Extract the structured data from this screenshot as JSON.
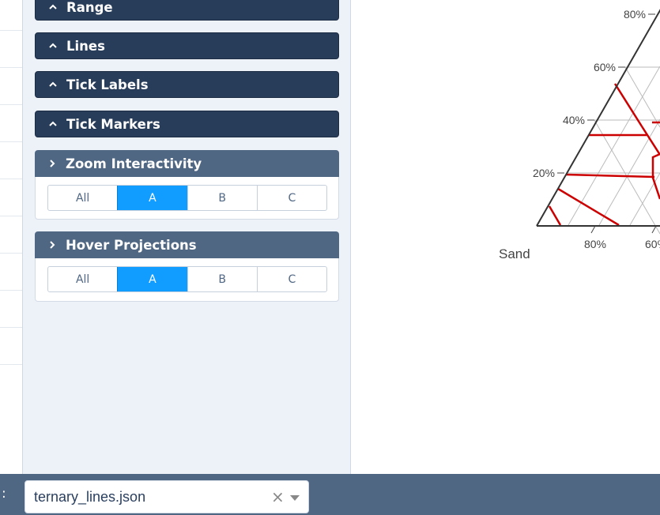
{
  "sections": [
    {
      "title": "Range",
      "state": "collapsed"
    },
    {
      "title": "Lines",
      "state": "collapsed"
    },
    {
      "title": "Tick Labels",
      "state": "collapsed"
    },
    {
      "title": "Tick Markers",
      "state": "collapsed"
    },
    {
      "title": "Zoom Interactivity",
      "state": "expanded",
      "options": [
        "All",
        "A",
        "B",
        "C"
      ],
      "selected": "A"
    },
    {
      "title": "Hover Projections",
      "state": "expanded",
      "options": [
        "All",
        "A",
        "B",
        "C"
      ],
      "selected": "A"
    }
  ],
  "plot": {
    "left_axis_ticks": [
      "80%",
      "60%",
      "40%",
      "20%"
    ],
    "bottom_axis_ticks": [
      "80%",
      "60%"
    ],
    "corner_label": "Sand",
    "line_color": "#cc0000",
    "grid_color": "#bbbbbb",
    "axis_color": "#333333"
  },
  "file_selector": {
    "label": ":",
    "value": "ternary_lines.json"
  },
  "colors": {
    "panel_bg": "#edf1f8",
    "header_dark": "#283d5a",
    "header_expanded": "#506783",
    "selected_option": "#119dff",
    "bottom_bar": "#506784"
  },
  "icons": {
    "collapsed_chevron": "chevron-up-icon",
    "expanded_chevron": "chevron-right-icon",
    "clear": "close-icon",
    "dropdown": "chevron-down-icon"
  }
}
